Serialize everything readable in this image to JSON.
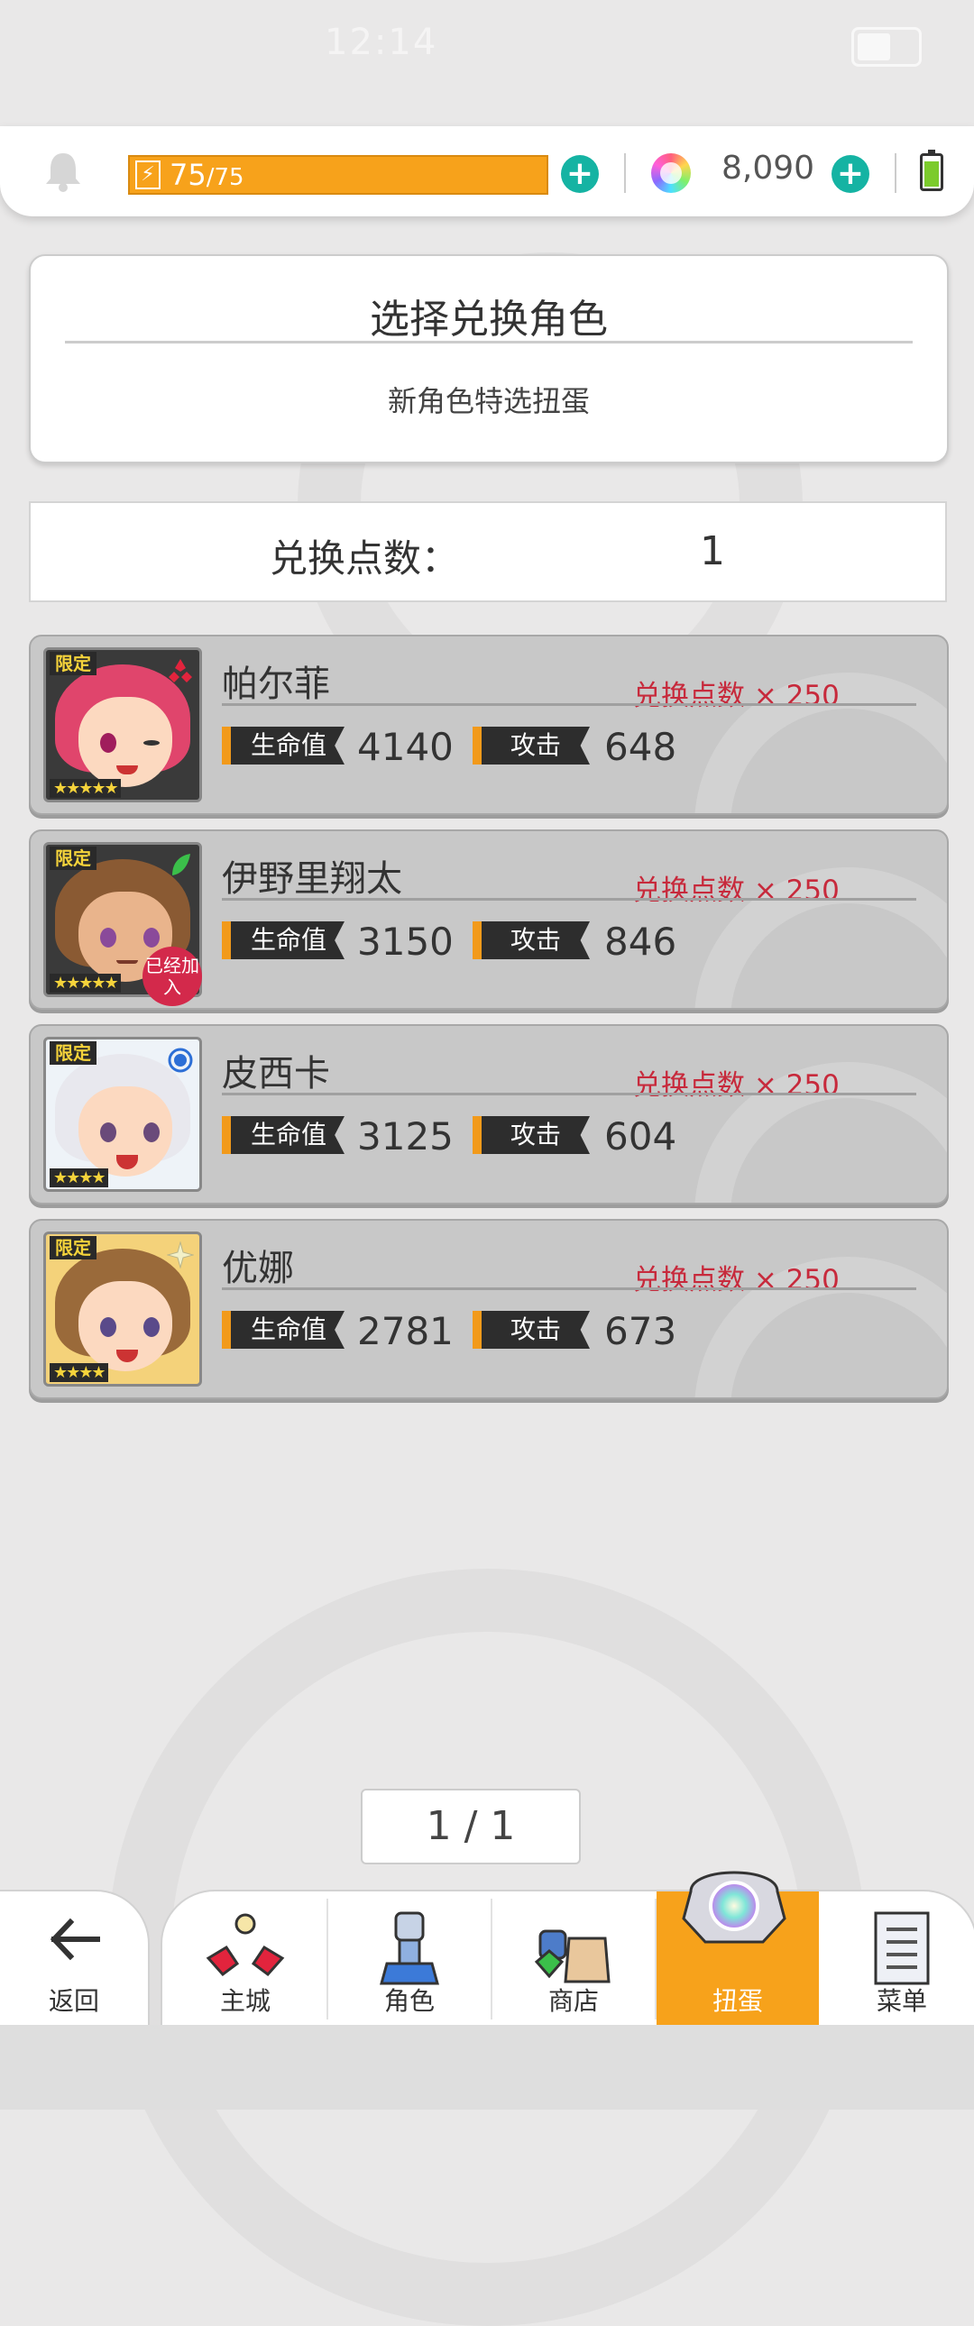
{
  "status_bar": {
    "time": "12:14"
  },
  "topbar": {
    "stamina_current": "75",
    "stamina_max": "/75",
    "gem_count": "8,090"
  },
  "title_card": {
    "title": "选择兑换角色",
    "subtitle": "新角色特选扭蛋"
  },
  "points": {
    "label": "兑换点数：",
    "value": "1"
  },
  "labels": {
    "hp": "生命值",
    "atk": "攻击",
    "limited": "限定",
    "joined": "已经加入"
  },
  "characters": [
    {
      "name": "帕尔菲",
      "cost": "兑换点数 × 250",
      "hp": "4140",
      "atk": "648",
      "stars": "★★★★★"
    },
    {
      "name": "伊野里翔太",
      "cost": "兑换点数 × 250",
      "hp": "3150",
      "atk": "846",
      "stars": "★★★★★"
    },
    {
      "name": "皮西卡",
      "cost": "兑换点数 × 250",
      "hp": "3125",
      "atk": "604",
      "stars": "★★★★"
    },
    {
      "name": "优娜",
      "cost": "兑换点数 × 250",
      "hp": "2781",
      "atk": "673",
      "stars": "★★★★"
    }
  ],
  "pagination": {
    "text": "1 / 1"
  },
  "nav": {
    "back": "返回",
    "main_city": "主城",
    "character": "角色",
    "shop": "商店",
    "gacha": "扭蛋",
    "menu": "菜单"
  },
  "colors": {
    "accent_orange": "#f7a21b",
    "teal_plus": "#15b3a3",
    "cost_red": "#c72a3c"
  }
}
